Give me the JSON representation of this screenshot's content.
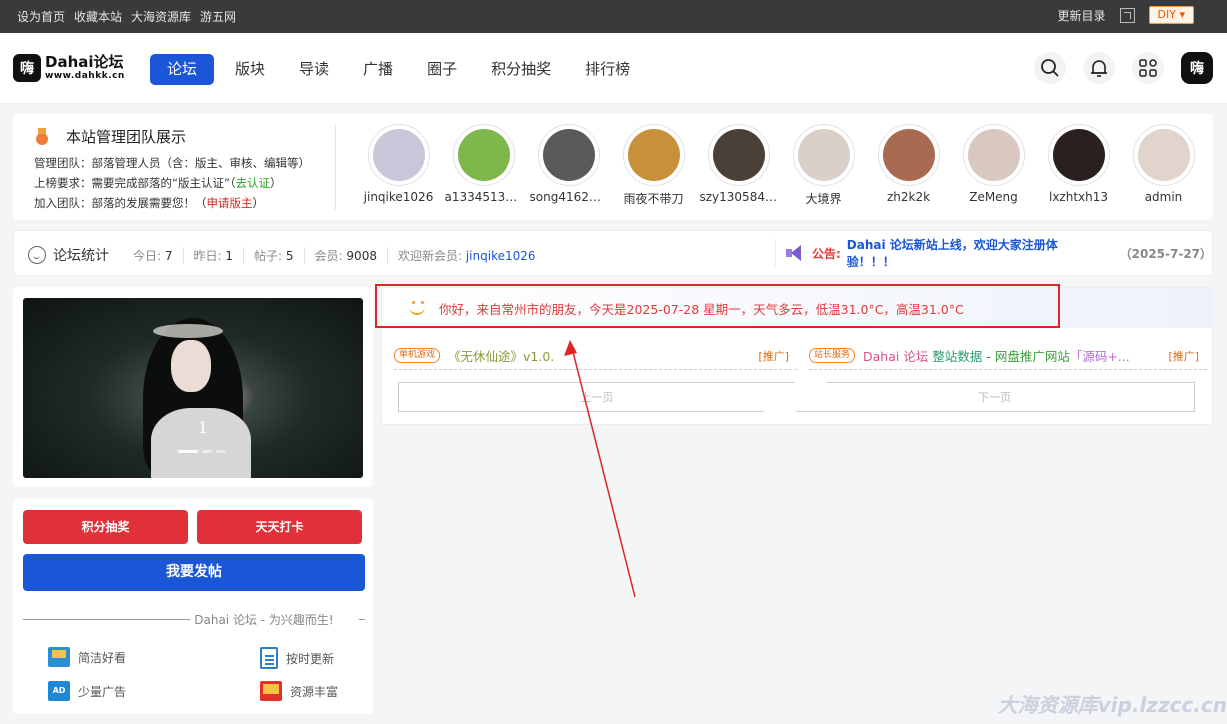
{
  "topbar": {
    "links": [
      "设为首页",
      "收藏本站",
      "大海资源库",
      "游五网"
    ],
    "update_label": "更新目录",
    "diy_label": "DIY"
  },
  "header": {
    "logo_mark": "嗨",
    "logo_title": "Dahai论坛",
    "logo_url_text": "www.dahkk.cn",
    "nav": [
      {
        "label": "论坛",
        "active": true
      },
      {
        "label": "版块"
      },
      {
        "label": "导读"
      },
      {
        "label": "广播"
      },
      {
        "label": "圈子"
      },
      {
        "label": "积分抽奖"
      },
      {
        "label": "排行榜"
      }
    ],
    "icons": [
      "search-icon",
      "bell-icon",
      "apps-icon",
      "avatar"
    ]
  },
  "team": {
    "title": "本站管理团队展示",
    "line1_label": "管理团队：",
    "line1_text": "部落管理人员（含：版主、审核、编辑等）",
    "line2_label": "上榜要求：",
    "line2_text": "需要完成部落的“版主认证”（",
    "line2_link": "去认证",
    "line2_end": "）",
    "line3_label": "加入团队：",
    "line3_text": "部落的发展需要您！（",
    "line3_link": "申请版主",
    "line3_end": "）",
    "members": [
      {
        "name": "jinqike1026",
        "color": "#c9c6d9"
      },
      {
        "name": "a1334513322",
        "color": "#7fb84a"
      },
      {
        "name": "song416281...",
        "color": "#5a5a5a"
      },
      {
        "name": "雨夜不带刀",
        "color": "#c8903a"
      },
      {
        "name": "szy1305845...",
        "color": "#4a4038"
      },
      {
        "name": "大境界",
        "color": "#d9cfc8"
      },
      {
        "name": "zh2k2k",
        "color": "#a86a50"
      },
      {
        "name": "ZeMeng",
        "color": "#d8c8c0"
      },
      {
        "name": "lxzhtxh13",
        "color": "#2a2020"
      },
      {
        "name": "admin",
        "color": "#e0d4cc"
      }
    ]
  },
  "stats": {
    "title": "论坛统计",
    "today_label": "今日:",
    "today_value": "7",
    "yesterday_label": "昨日:",
    "yesterday_value": "1",
    "posts_label": "帖子:",
    "posts_value": "5",
    "members_label": "会员:",
    "members_value": "9008",
    "new_member_label": "欢迎新会员:",
    "new_member_name": "jinqike1026",
    "notice_label": "公告:",
    "notice_text": "Dahai 论坛新站上线，欢迎大家注册体验！！！",
    "notice_date": "（2025-7-27）"
  },
  "slider": {
    "index_label": "1"
  },
  "actions": {
    "lottery_label": "积分抽奖",
    "checkin_label": "天天打卡",
    "post_label": "我要发帖",
    "slogan": "Dahai 论坛 - 为兴趣而生!",
    "features": [
      "简洁好看",
      "按时更新",
      "少量广告",
      "资源丰富"
    ]
  },
  "content": {
    "greeting": "你好，来自常州市的朋友，今天是2025-07-28 星期一，天气多云，低温31.0°C，高温31.0°C",
    "rec1_tag": "单机游戏",
    "rec1_title": "《无休仙途》v1.0.",
    "rec1_promo": "[推广]",
    "rec2_tag": "站长服务",
    "rec2_p1": "Dahai 论坛",
    "rec2_p2": "整站数据",
    "rec2_p3": " - ",
    "rec2_p4": "网盘推广网站",
    "rec2_p5": "「源码+...",
    "rec2_promo": "[推广]",
    "prev_label": "上一页",
    "next_label": "下一页"
  },
  "watermark": "大海资源库vip.lzzcc.cn"
}
